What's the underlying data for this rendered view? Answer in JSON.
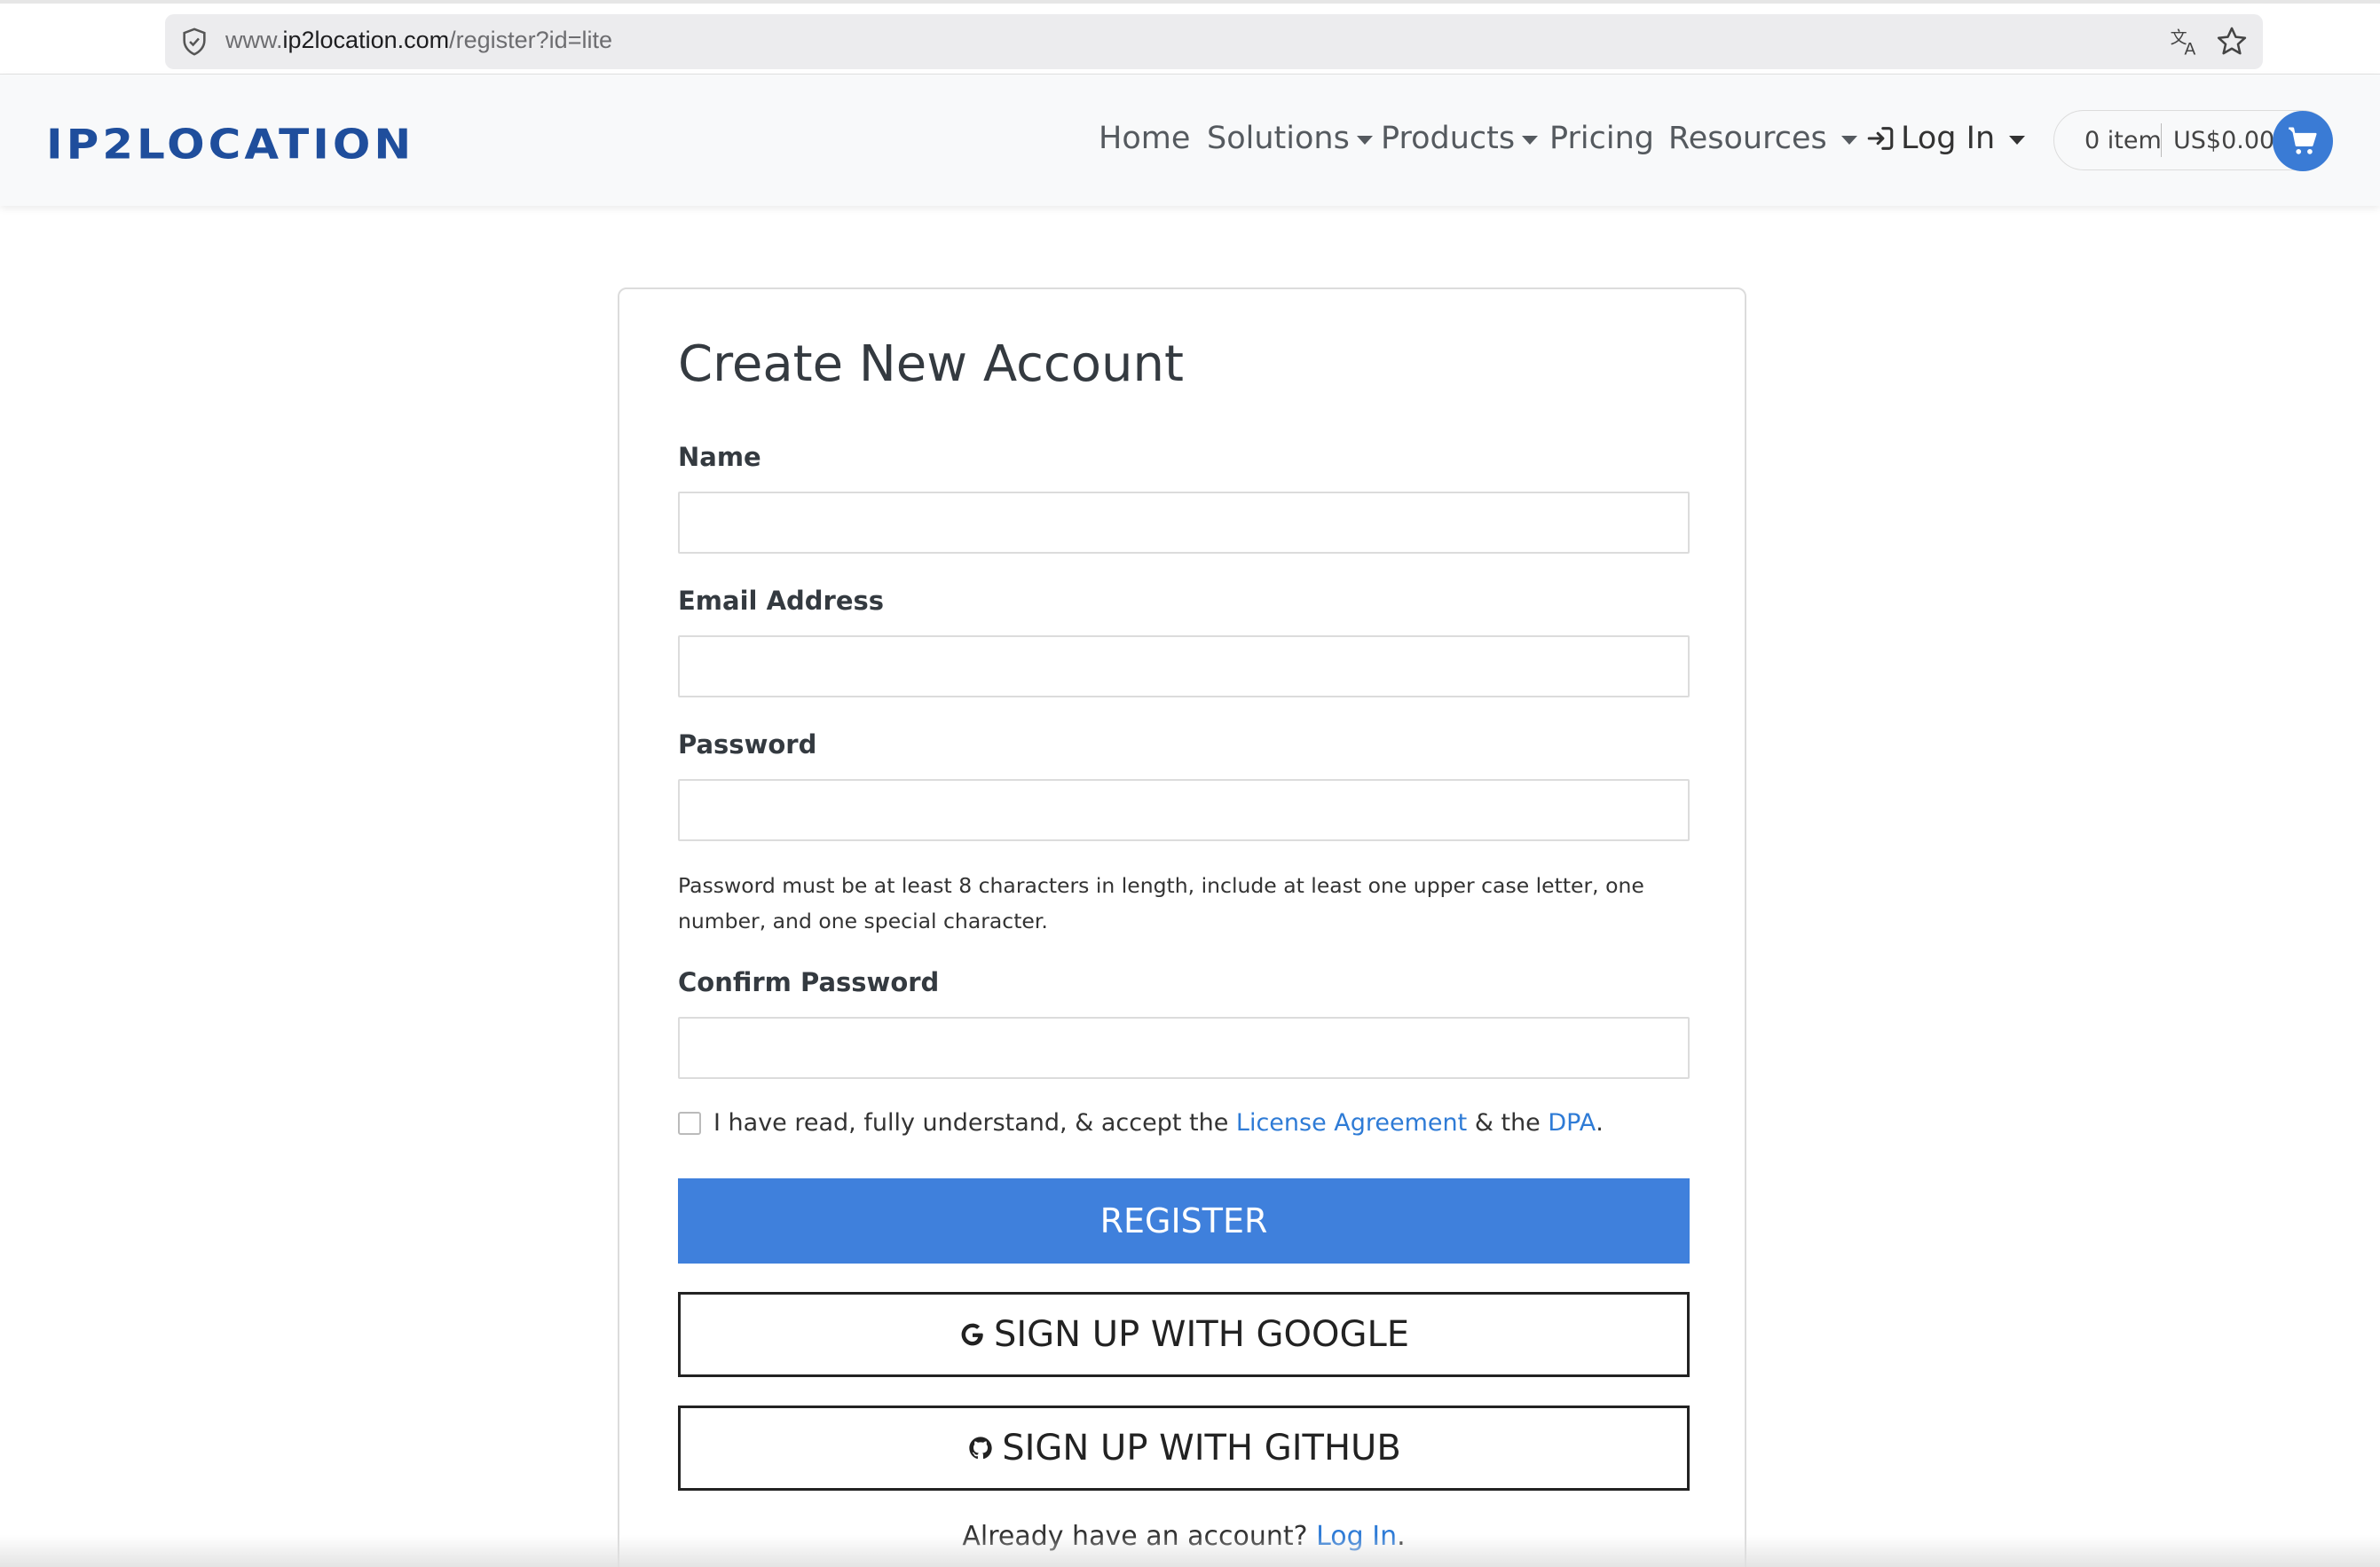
{
  "browser": {
    "url_prefix": "www.",
    "url_host": "ip2location.com",
    "url_path": "/register?id=lite",
    "icons": [
      "shield-icon",
      "translate-icon",
      "bookmark-star-icon"
    ]
  },
  "navbar": {
    "logo": "IP2LOCATION",
    "items": [
      {
        "label": "Home"
      },
      {
        "label": "Solutions"
      },
      {
        "label": "Products"
      },
      {
        "label": "Pricing"
      },
      {
        "label": "Resources"
      },
      {
        "label": "Log In"
      }
    ],
    "cart": {
      "count": "0 item",
      "amount": "US$0.00"
    }
  },
  "form": {
    "title": "Create New Account",
    "name_label": "Name",
    "name_value": "",
    "email_label": "Email Address",
    "email_value": "",
    "password_label": "Password",
    "password_value": "",
    "password_hint": "Password must be at least 8 characters in length, include at least one upper case letter, one number, and one special character.",
    "confirm_label": "Confirm Password",
    "confirm_value": "",
    "agree_text_1": "I have read, fully understand, & accept the",
    "agree_link_1": "License Agreement",
    "agree_text_2": "& the",
    "agree_link_2": "DPA",
    "agree_text_3": ".",
    "agree_checked": false,
    "register_label": "REGISTER",
    "google_label": "SIGN UP WITH GOOGLE",
    "github_label": "SIGN UP WITH GITHUB",
    "already_text": "Already have an account?",
    "login_link": "Log In",
    "already_end": "."
  },
  "colors": {
    "brand": "#1f4e9c",
    "primary": "#3f80dc",
    "link": "#2e7bd6"
  }
}
